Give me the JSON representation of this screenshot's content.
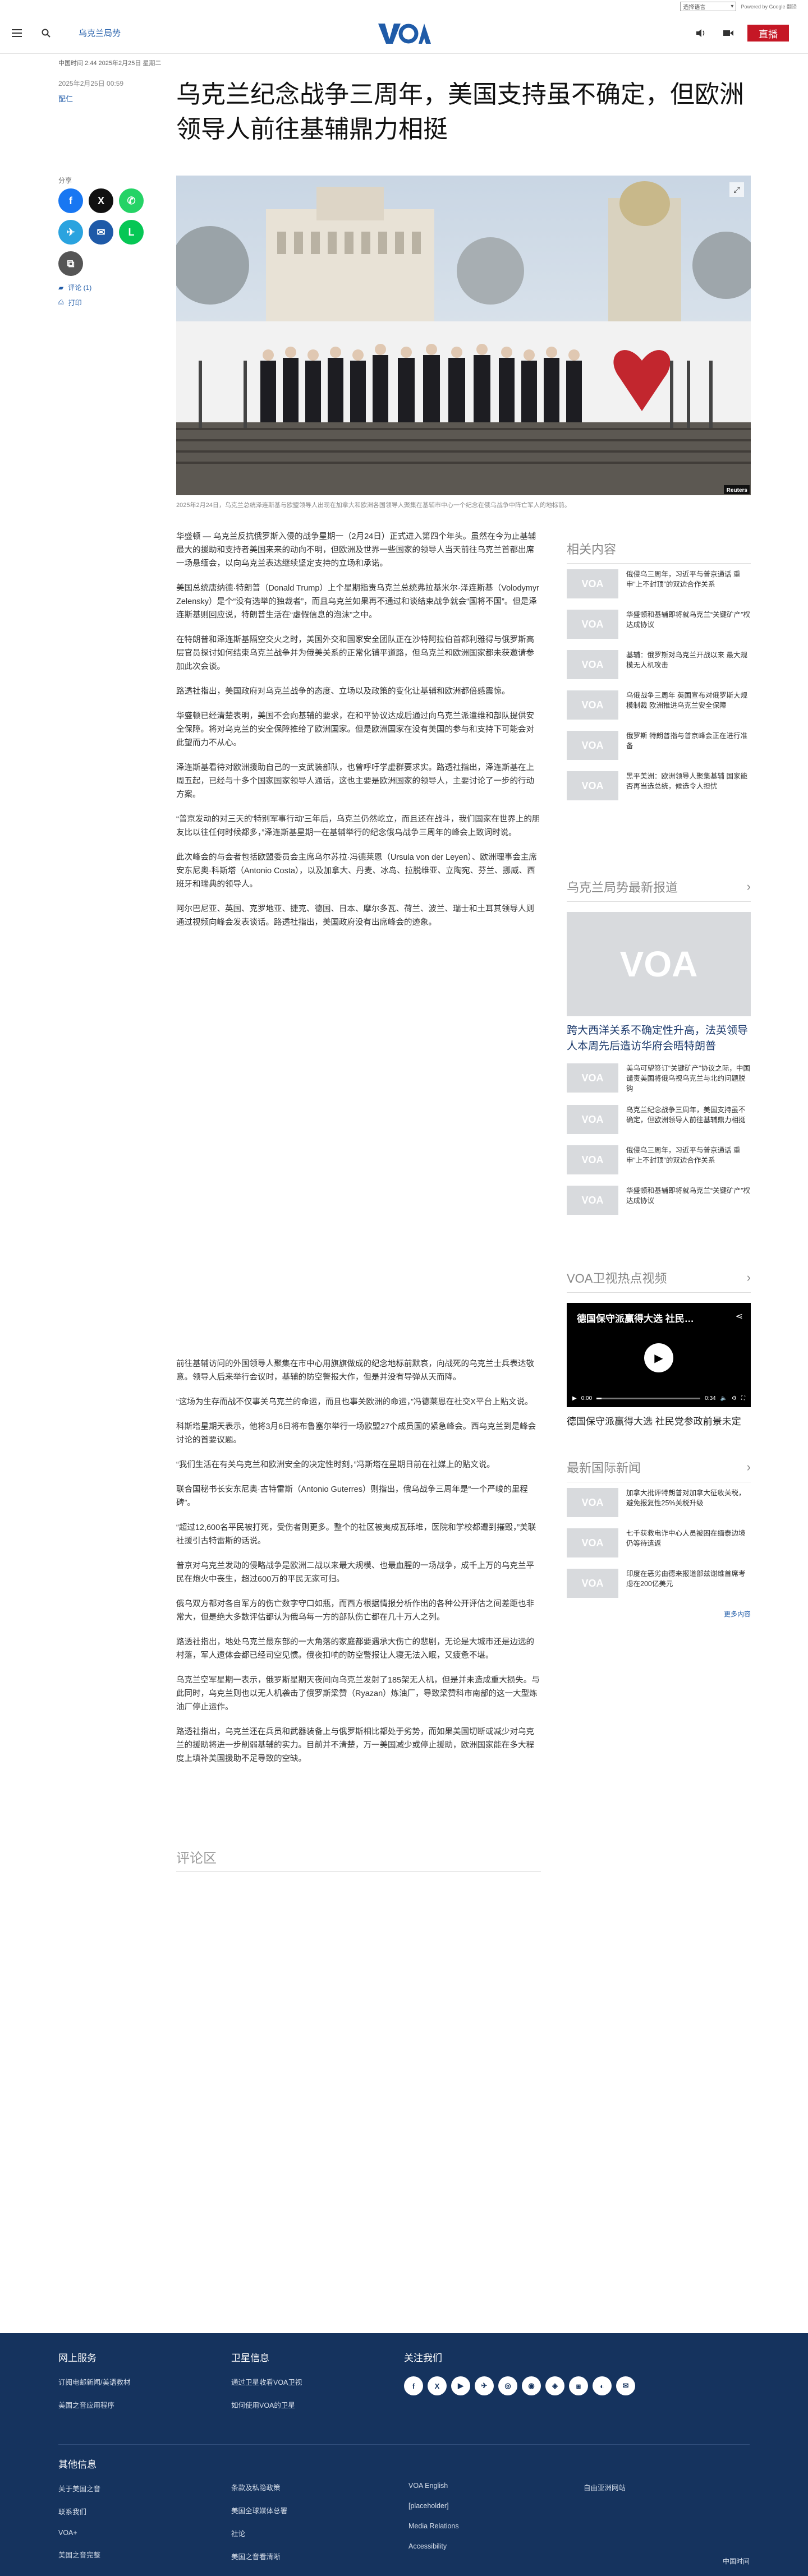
{
  "util": {
    "language_select": "选择语言",
    "translate_label": "Powered by Google 翻译"
  },
  "header": {
    "section_link": "乌克兰局势",
    "live_label": "直播"
  },
  "article": {
    "dateline": "中国时间 2:44 2025年2月25日 星期二",
    "meta": "2025年2月25日 00:59",
    "author": "配仁",
    "title": "乌克兰纪念战争三周年，美国支持虽不确定，但欧洲领导人前往基辅鼎力相挺",
    "photo_credit": "Reuters",
    "caption": "2025年2月24日，乌克兰总统泽连斯基与欧盟领导人出现在加拿大和欧洲各国领导人聚集在基辅市中心一个纪念在俄乌战争中阵亡军人的地标前。",
    "paragraphs_1": [
      "华盛顿 — 乌克兰反抗俄罗斯入侵的战争星期一（2月24日）正式进入第四个年头。虽然在今为止基辅最大的援助和支持者美国来来的动向不明，但欧洲及世界一些国家的领导人当天前往乌克兰首都出席一场悬缅会，以向乌克兰表达继续坚定支持的立场和承诺。",
      "美国总统唐纳德·特朗普（Donald Trump）上个星期指责乌克兰总统弗拉基米尔·泽连斯基（Volodymyr Zelensky）是个“没有选举的独裁者”，而且乌克兰如果再不通过和谈结束战争就会“国将不国”。但是泽连斯基则回应说，特朗普生活在“虚假信息的泡沫”之中。",
      "在特朗普和泽连斯基隔空交火之时，美国外交和国家安全团队正在沙特阿拉伯首都利雅得与俄罗斯高层官员探讨如何结束乌克兰战争并为俄美关系的正常化铺平道路，但乌克兰和欧洲国家都未获邀请参加此次会谈。",
      "路透社指出，美国政府对乌克兰战争的态度、立场以及政策的变化让基辅和欧洲都倍感震惊。",
      "华盛顿已经清楚表明，美国不会向基辅的要求，在和平协议达成后通过向乌克兰派遣维和部队提供安全保障。将对乌克兰的安全保障推给了欧洲国家。但是欧洲国家在没有美国的参与和支持下可能会对此望而力不从心。",
      "泽连斯基看待对欧洲援助自己的一支武装部队，也曾呼吁学虚群要求实。路透社指出，泽连斯基在上周五起，已经与十多个国家国家领导人通话，这也主要是欧洲国家的领导人，主要讨论了一步的行动方案。",
      "“普京发动的对三天的'特别军事行动'三年后，乌克兰仍然屹立，而且还在战斗，我们国家在世界上的朋友比以往任何时候都多，”泽连斯基星期一在基辅举行的纪念俄乌战争三周年的峰会上致词时说。",
      "此次峰会的与会者包括欧盟委员会主席乌尔苏拉·冯德莱恩（Ursula von der Leyen）、欧洲理事会主席安东尼奥·科斯塔（Antonio Costa），以及加拿大、丹麦、冰岛、拉脱维亚、立陶宛、芬兰、挪威、西班牙和瑞典的领导人。",
      "阿尔巴尼亚、英国、克罗地亚、捷克、德国、日本、摩尔多瓦、荷兰、波兰、瑞士和土耳其领导人则通过视频向峰会发表谈话。路透社指出，美国政府没有出席峰会的迹象。"
    ],
    "paragraphs_2": [
      "前往基辅访问的外国领导人聚集在市中心用旗旗做成的纪念地标前默哀，向战死的乌克兰士兵表达敬意。领导人后来举行会议时，基辅的防空警报大作，但是并没有导弹从天而降。",
      "“这场为生存而战不仅事关乌克兰的命运，而且也事关欧洲的命运，”冯德莱恩在社交X平台上贴文说。",
      "科斯塔星期天表示，他将3月6日将布鲁塞尔举行一场欧盟27个成员国的紧急峰会。西乌克兰到是峰会讨论的首要议题。",
      "“我们生活在有关乌克兰和欧洲安全的决定性时刻，”冯斯塔在星期日前在社媒上的贴文说。",
      "联合国秘书长安东尼奥·古特雷斯（Antonio Guterres）则指出，俄乌战争三周年是“一个严峻的里程碑”。",
      "“超过12,600名平民被打死，受伤者则更多。整个的社区被夷成瓦砾堆，医院和学校都遭到摧毁，”美联社援引古特雷斯的话说。",
      "普京对乌克兰发动的侵略战争是欧洲二战以来最大规模、也最血腥的一场战争，成千上万的乌克兰平民在炮火中丧生，超过600万的平民无家可归。",
      "俄乌双方都对各自军方的伤亡数字守口如瓶，而西方根据情报分析作出的各种公开评估之间差距也非常大，但是绝大多数评估都认为俄乌每一方的部队伤亡都在几十万人之列。",
      "路透社指出，地处乌克兰最东部的一大角落的家庭都要遇承大伤亡的悲剧，无论是大城市还是边远的村落，军人遗体会都已经司空见惯。俄夜扣响的防空警报让人寝无法入眠，又疲惫不堪。",
      "乌克兰空军星期一表示，俄罗斯星期天夜间向乌克兰发射了185架无人机，但是并未造成重大损失。与此同时，乌克兰则也以无人机袭击了俄罗斯梁赞（Ryazan）炼油厂，导致梁赞科市南部的这一大型炼油厂停止运作。",
      "路透社指出，乌克兰还在兵员和武器装备上与俄罗斯相比都处于劣势，而如果美国切断或减少对乌克兰的援助将进一步削弱基辅的实力。目前并不清楚，万一美国减少或停止援助，欧洲国家能在多大程度上填补美国援助不足导致的空缺。"
    ],
    "comments_heading": "评论区"
  },
  "share": {
    "label": "分享",
    "comments_link": "评论 (1)",
    "print_link": "打印"
  },
  "sidebar": {
    "related_heading": "相关内容",
    "related": [
      "俄侵乌三周年，习近平与普京通话 重申“上不封顶”的双边合作关系",
      "华盛顿和基辅即将就乌克兰“关键矿产”权达成协议",
      "基辅：俄罗斯对乌克兰开战以来 最大规模无人机攻击",
      "乌俄战争三周年 英国宣布对俄罗斯大规模制裁 欧洲推进乌克兰安全保障",
      "俄罗斯 特朗普指与普京峰会正在进行准备",
      "黑平美洲：欧洲领导人聚集基辅 国家能否再当选总统，候选令人担忧"
    ],
    "latest_heading": "乌克兰局势最新报道",
    "latest_big_title": "跨大西洋关系不确定性升高，法英领导人本周先后造访华府会晤特朗普",
    "latest": [
      "美乌可望签订“关键矿产”协议之际，中国谴责美国将俄乌视乌克兰与北约问题脱钩",
      "乌克兰纪念战争三周年，美国支持虽不确定，但欧洲领导人前往基辅鼎力相挺",
      "俄侵乌三周年，习近平与普京通话 重申“上不封顶”的双边合作关系",
      "华盛顿和基辅即将就乌克兰“关键矿产”权达成协议"
    ],
    "video_heading": "VOA卫视热点视频",
    "video_overlay_title": "德国保守派赢得大选 社民…",
    "video_time_current": "0:00",
    "video_time_total": "0:34",
    "video_caption": "德国保守派赢得大选 社民党参政前景未定",
    "news_heading": "最新国际新闻",
    "news": [
      "加拿大批评特朗普对加拿大征收关税，避免报复性25%关税升级",
      "七千获救电诈中心人员被困在缅泰边境仍等待遣返",
      "印度在恶劣由德来报道部兹谢维首席考虑在200亿美元"
    ],
    "more_link": "更多内容"
  },
  "footer": {
    "col1_heading": "网上服务",
    "col1_links": [
      "订阅电邮新闻/美语教材",
      "美国之音应用程序"
    ],
    "col2_heading": "卫星信息",
    "col2_links": [
      "通过卫星收看VOA卫视",
      "如何使用VOA的卫星"
    ],
    "col3_heading": "关注我们",
    "social_icons": [
      "f",
      "X",
      "▶",
      "✈",
      "◎",
      "◉",
      "◈",
      "◙",
      "◐",
      "✉"
    ],
    "other_heading": "其他信息",
    "other_col1": [
      "关于美国之音",
      "联系我们",
      "VOA+",
      "美国之音完整"
    ],
    "other_col2": [
      "条款及私隐政策",
      "美国全球媒体总署",
      "社论",
      "美国之音看清晰"
    ],
    "other_col3": [
      "VOA English",
      "[placeholder]",
      "Media Relations",
      "Accessibility"
    ],
    "other_col4": [
      "自由亚洲网站"
    ],
    "copyright": "中国时间"
  }
}
